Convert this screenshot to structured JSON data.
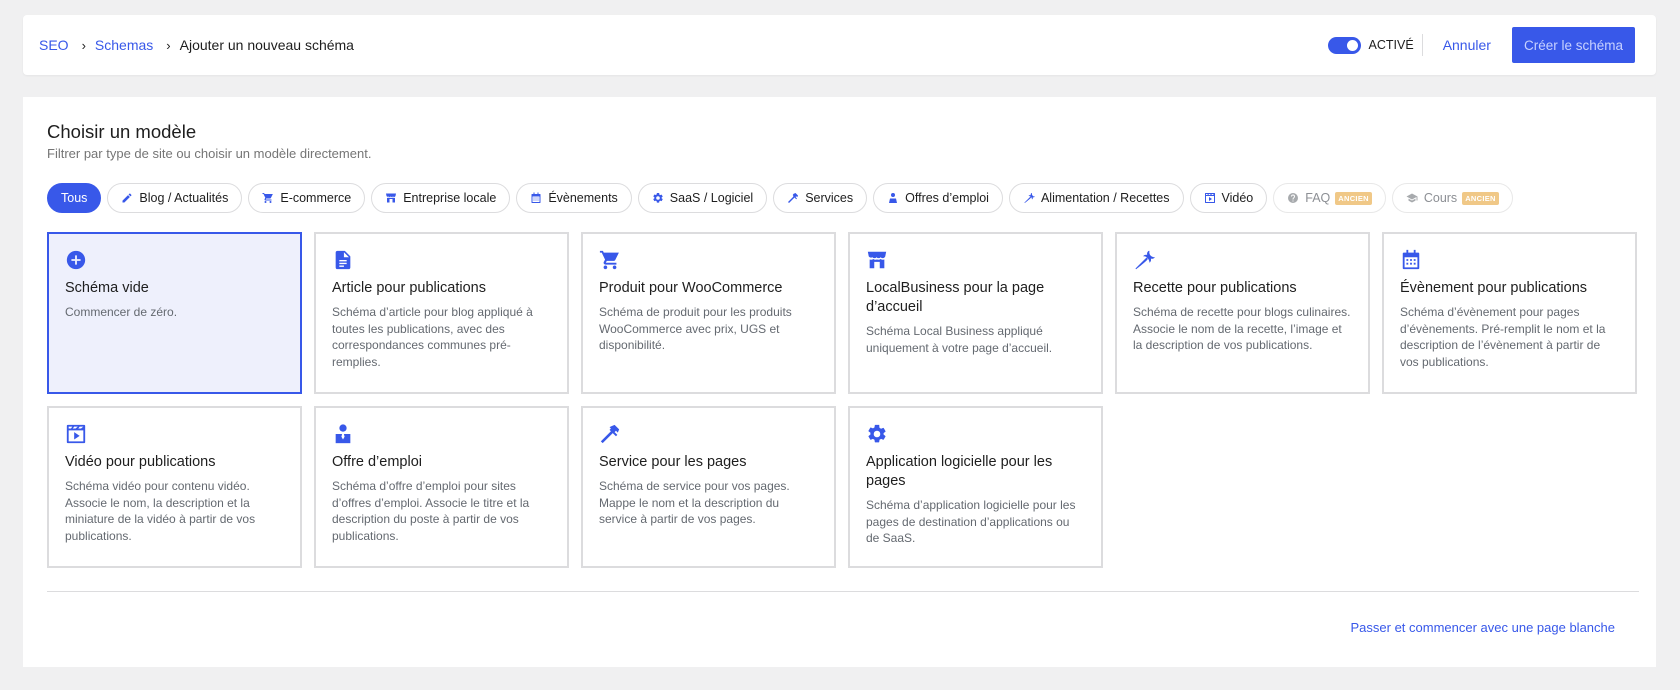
{
  "breadcrumb": {
    "items": [
      "SEO",
      "Schemas"
    ],
    "current": "Ajouter un nouveau schéma"
  },
  "header": {
    "toggle_label": "ACTIVÉ",
    "cancel_label": "Annuler",
    "create_label": "Créer le schéma"
  },
  "panel": {
    "title": "Choisir un modèle",
    "subtitle": "Filtrer par type de site ou choisir un modèle directement."
  },
  "filters": [
    {
      "label": "Tous",
      "icon": "none",
      "active": true
    },
    {
      "label": "Blog / Actualités",
      "icon": "pencil-icon"
    },
    {
      "label": "E-commerce",
      "icon": "cart-icon"
    },
    {
      "label": "Entreprise locale",
      "icon": "store-icon"
    },
    {
      "label": "Évènements",
      "icon": "calendar-icon"
    },
    {
      "label": "SaaS / Logiciel",
      "icon": "gear-icon"
    },
    {
      "label": "Services",
      "icon": "hammer-icon"
    },
    {
      "label": "Offres d’emploi",
      "icon": "people-icon"
    },
    {
      "label": "Alimentation / Recettes",
      "icon": "carrot-icon"
    },
    {
      "label": "Vidéo",
      "icon": "video-icon"
    },
    {
      "label": "FAQ",
      "icon": "help-icon",
      "badge": "ANCIEN",
      "legacy": true
    },
    {
      "label": "Cours",
      "icon": "graduation-icon",
      "badge": "ANCIEN",
      "legacy": true
    }
  ],
  "templates": [
    {
      "title": "Schéma vide",
      "desc": "Commencer de zéro.",
      "icon": "plus-circle-icon",
      "selected": true
    },
    {
      "title": "Article pour publications",
      "desc": "Schéma d’article pour blog appliqué à toutes les publications, avec des correspondances communes pré-remplies.",
      "icon": "document-icon"
    },
    {
      "title": "Produit pour WooCommerce",
      "desc": "Schéma de produit pour les produits WooCommerce avec prix, UGS et disponibilité.",
      "icon": "cart-icon"
    },
    {
      "title": "LocalBusiness pour la page d’accueil",
      "desc": "Schéma Local Business appliqué uniquement à votre page d’accueil.",
      "icon": "store-icon"
    },
    {
      "title": "Recette pour publications",
      "desc": "Schéma de recette pour blogs culinaires. Associe le nom de la recette, l’image et la description de vos publications.",
      "icon": "carrot-icon"
    },
    {
      "title": "Évènement pour publications",
      "desc": "Schéma d’évènement pour pages d’évènements. Pré-remplit le nom et la description de l’évènement à partir de vos publications.",
      "icon": "calendar-icon"
    },
    {
      "title": "Vidéo pour publications",
      "desc": "Schéma vidéo pour contenu vidéo. Associe le nom, la description et la miniature de la vidéo à partir de vos publications.",
      "icon": "video-icon"
    },
    {
      "title": "Offre d’emploi",
      "desc": "Schéma d’offre d’emploi pour sites d’offres d’emploi. Associe le titre et la description du poste à partir de vos publications.",
      "icon": "person-icon"
    },
    {
      "title": "Service pour les pages",
      "desc": "Schéma de service pour vos pages. Mappe le nom et la description du service à partir de vos pages.",
      "icon": "hammer-icon"
    },
    {
      "title": "Application logicielle pour les pages",
      "desc": "Schéma d’application logicielle pour les pages de destination d’applications ou de SaaS.",
      "icon": "gear-icon"
    }
  ],
  "footer": {
    "skip_label": "Passer et commencer avec une page blanche"
  },
  "colors": {
    "accent": "#3858e9",
    "selected_bg": "#eef0fc",
    "badge": "#f0c887"
  }
}
